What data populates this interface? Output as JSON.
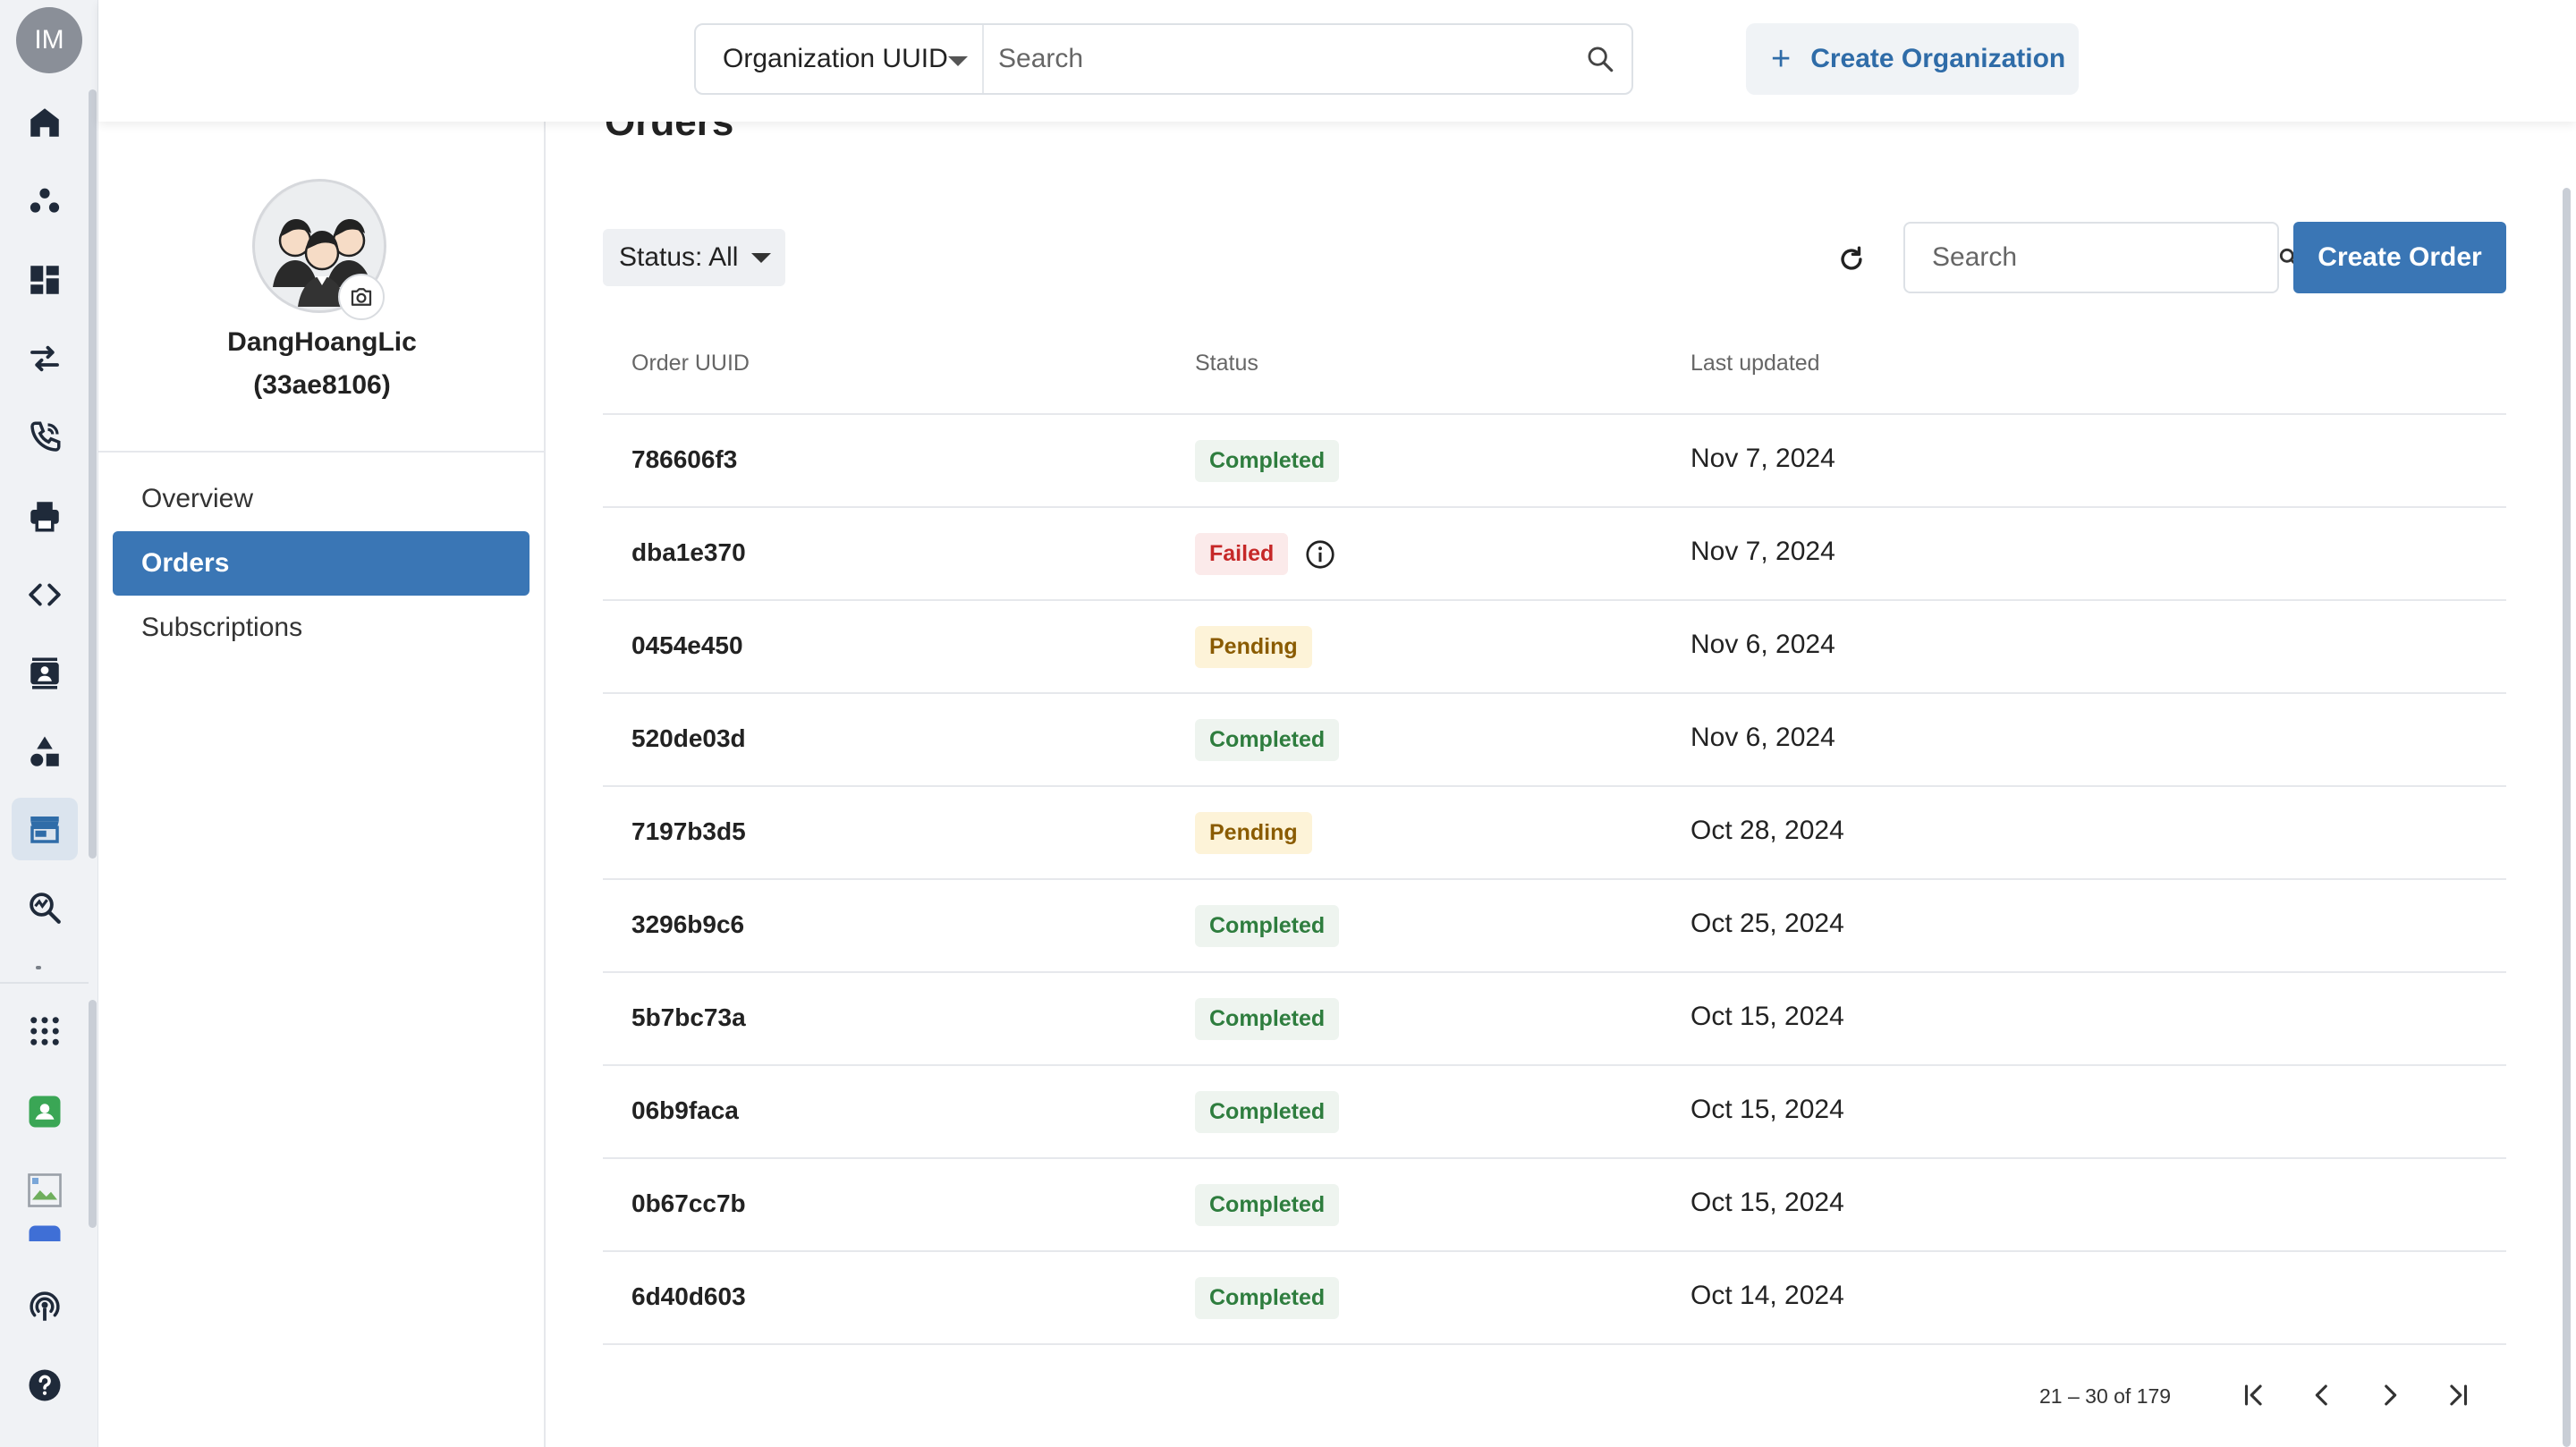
{
  "rail": {
    "user_initials": "IM",
    "icons": [
      "home-icon",
      "groups-icon",
      "dashboard-icon",
      "transfer-icon",
      "phone-icon",
      "printer-icon",
      "code-icon",
      "contacts-icon",
      "shapes-icon",
      "store-icon",
      "analytics-icon",
      "apps-grid-icon",
      "app-badge-icon",
      "broken-image-icon",
      "podcast-icon",
      "help-icon"
    ]
  },
  "topbar": {
    "org_select_label": "Organization UUID",
    "search_placeholder": "Search",
    "create_org_label": "Create Organization"
  },
  "profile": {
    "name": "DangHoangLic",
    "id": "(33ae8106)"
  },
  "nav": {
    "items": [
      {
        "label": "Overview",
        "active": false
      },
      {
        "label": "Orders",
        "active": true
      },
      {
        "label": "Subscriptions",
        "active": false
      }
    ]
  },
  "main": {
    "title": "Orders",
    "status_filter_label": "Status: All",
    "search_placeholder": "Search",
    "create_order_label": "Create Order"
  },
  "table": {
    "headers": [
      "Order UUID",
      "Status",
      "Last updated"
    ],
    "rows": [
      {
        "uuid": "786606f3",
        "status": "Completed",
        "date": "Nov 7, 2024"
      },
      {
        "uuid": "dba1e370",
        "status": "Failed",
        "date": "Nov 7, 2024"
      },
      {
        "uuid": "0454e450",
        "status": "Pending",
        "date": "Nov 6, 2024"
      },
      {
        "uuid": "520de03d",
        "status": "Completed",
        "date": "Nov 6, 2024"
      },
      {
        "uuid": "7197b3d5",
        "status": "Pending",
        "date": "Oct 28, 2024"
      },
      {
        "uuid": "3296b9c6",
        "status": "Completed",
        "date": "Oct 25, 2024"
      },
      {
        "uuid": "5b7bc73a",
        "status": "Completed",
        "date": "Oct 15, 2024"
      },
      {
        "uuid": "06b9faca",
        "status": "Completed",
        "date": "Oct 15, 2024"
      },
      {
        "uuid": "0b67cc7b",
        "status": "Completed",
        "date": "Oct 15, 2024"
      },
      {
        "uuid": "6d40d603",
        "status": "Completed",
        "date": "Oct 14, 2024"
      }
    ]
  },
  "pagination": {
    "range_text": "21 – 30 of 179"
  },
  "colors": {
    "accent": "#3a76b5",
    "link": "#2f6ca8",
    "completed": "#2e7d3e",
    "failed": "#c62828",
    "pending": "#8a5b00"
  }
}
